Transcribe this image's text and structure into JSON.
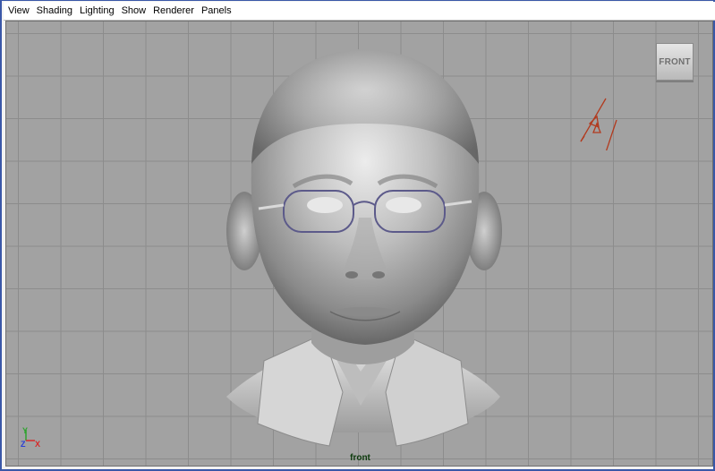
{
  "menubar": {
    "items": [
      "View",
      "Shading",
      "Lighting",
      "Show",
      "Renderer",
      "Panels"
    ]
  },
  "viewport": {
    "view_cube_label": "FRONT",
    "camera_label": "front",
    "axes": {
      "y": "Y",
      "z": "Z",
      "x": "X"
    }
  },
  "colors": {
    "frame_border": "#3a58a8",
    "viewport_background": "#a2a2a2",
    "grid_line": "#8c8c8c",
    "axis_y": "#2ea32e",
    "axis_z": "#2a3fd6",
    "axis_x": "#d62a2a",
    "camera_icon": "#b23a1e"
  },
  "icons": {
    "view_cube": "view-cube-icon",
    "camera": "camera-icon",
    "axis": "axis-gizmo-icon"
  }
}
